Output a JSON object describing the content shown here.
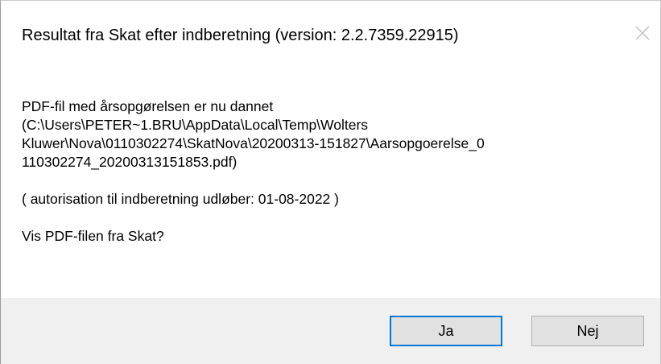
{
  "dialog": {
    "title": "Resultat fra Skat efter indberetning (version: 2.2.7359.22915)",
    "close_icon": "close-icon"
  },
  "message": {
    "line1": "PDF-fil med årsopgørelsen er nu dannet",
    "path_line1": "(C:\\Users\\PETER~1.BRU\\AppData\\Local\\Temp\\Wolters",
    "path_line2": "Kluwer\\Nova\\0110302274\\SkatNova\\20200313-151827\\Aarsopgoerelse_0",
    "path_line3": "110302274_20200313151853.pdf)",
    "authorization": "( autorisation til indberetning udløber: 01-08-2022 )",
    "question": "Vis PDF-filen fra Skat?"
  },
  "buttons": {
    "yes_label": "Ja",
    "no_label": "Nej"
  },
  "colors": {
    "footer_bg": "#f0f0f0",
    "button_bg": "#e1e1e1",
    "default_button_border": "#0078d7"
  }
}
